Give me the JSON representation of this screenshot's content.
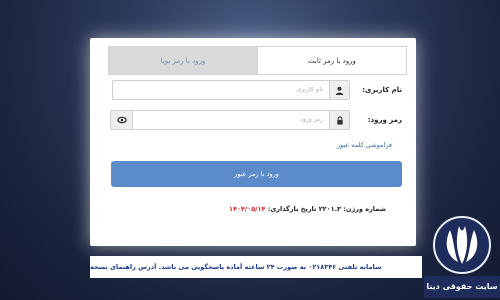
{
  "tabs": {
    "fixed_password": "ورود با رمز ثابت",
    "dynamic_password": "ورود با رمز پویا"
  },
  "form": {
    "username_label": "نام کاربری:",
    "username_placeholder": "نام کاربری",
    "password_label": "رمز ورود:",
    "password_placeholder": "رمز ورود",
    "forgot_link": "فراموشی کلمه عبور",
    "submit_label": "ورود با رمز عبور"
  },
  "version": {
    "prefix": "شماره ورژن: ",
    "number": "۲۲۰۱.۳",
    "date_label": " تاریخ بارگذاری: ",
    "date": "۱۴۰۴/۰۵/۱۴"
  },
  "footer": {
    "text": "سامانه تلفنی ۰۲۱۸۳۴۶ به صورت ۲۴ ساعته آماده پاسخگویی می باشد. آدرس راهنمای نسخه"
  },
  "watermark": {
    "site_name": "سایت حقوقی دینا"
  },
  "colors": {
    "accent": "#5c8bc9",
    "link": "#3a6fb0",
    "date_red": "#d42b2b",
    "brand_navy": "#1e2c5c"
  },
  "icons": {
    "username_addon": "user-icon",
    "password_addon": "lock-icon",
    "show_password": "eye-icon"
  }
}
